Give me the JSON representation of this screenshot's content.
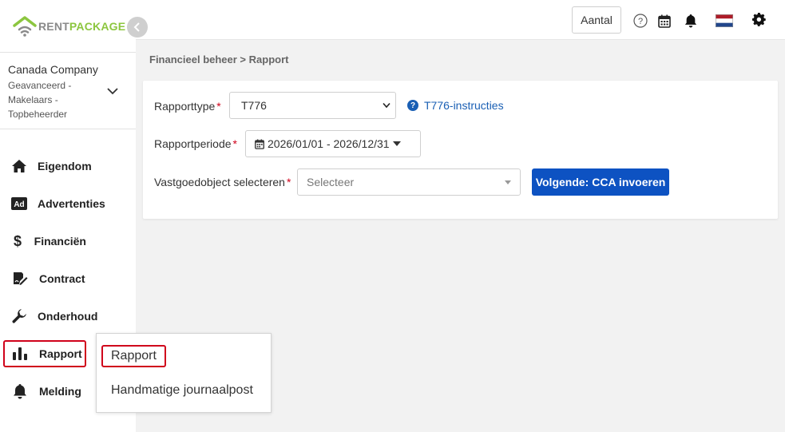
{
  "brand": {
    "part1": "RENT",
    "part2": "PACKAGE",
    "color_primary": "#8cc63f",
    "color_secondary": "#8a8a8a"
  },
  "account": {
    "company": "Canada Company",
    "role_lines": [
      "Geavanceerd -",
      "Makelaars -",
      "Topbeheerder"
    ]
  },
  "sidebar": {
    "items": [
      {
        "label": "Eigendom",
        "icon": "home-icon"
      },
      {
        "label": "Advertenties",
        "icon": "ad-icon"
      },
      {
        "label": "Financiën",
        "icon": "dollar-icon"
      },
      {
        "label": "Contract",
        "icon": "contract-icon"
      },
      {
        "label": "Onderhoud",
        "icon": "wrench-icon"
      },
      {
        "label": "Rapport",
        "icon": "bar-chart-icon",
        "active": true
      },
      {
        "label": "Melding",
        "icon": "bell-icon"
      }
    ]
  },
  "submenu": {
    "items": [
      "Rapport",
      "Handmatige journaalpost"
    ]
  },
  "header": {
    "aantal_label": "Aantal",
    "icons": [
      "help-icon",
      "calendar-icon",
      "bell-icon",
      "flag-nl-icon",
      "gear-icon"
    ]
  },
  "breadcrumb": "Financieel beheer > Rapport",
  "form": {
    "report_type_label": "Rapporttype",
    "report_type_value": "T776",
    "help_link_label": "T776-instructies",
    "period_label": "Rapportperiode",
    "period_value": "2026/01/01 - 2026/12/31",
    "property_label": "Vastgoedobject selecteren",
    "property_placeholder": "Selecteer",
    "next_button_label": "Volgende: CCA invoeren",
    "required_mark": "*"
  },
  "colors": {
    "accent": "#0d52c2",
    "highlight_border": "#d0021b",
    "link": "#1a5fb4"
  }
}
